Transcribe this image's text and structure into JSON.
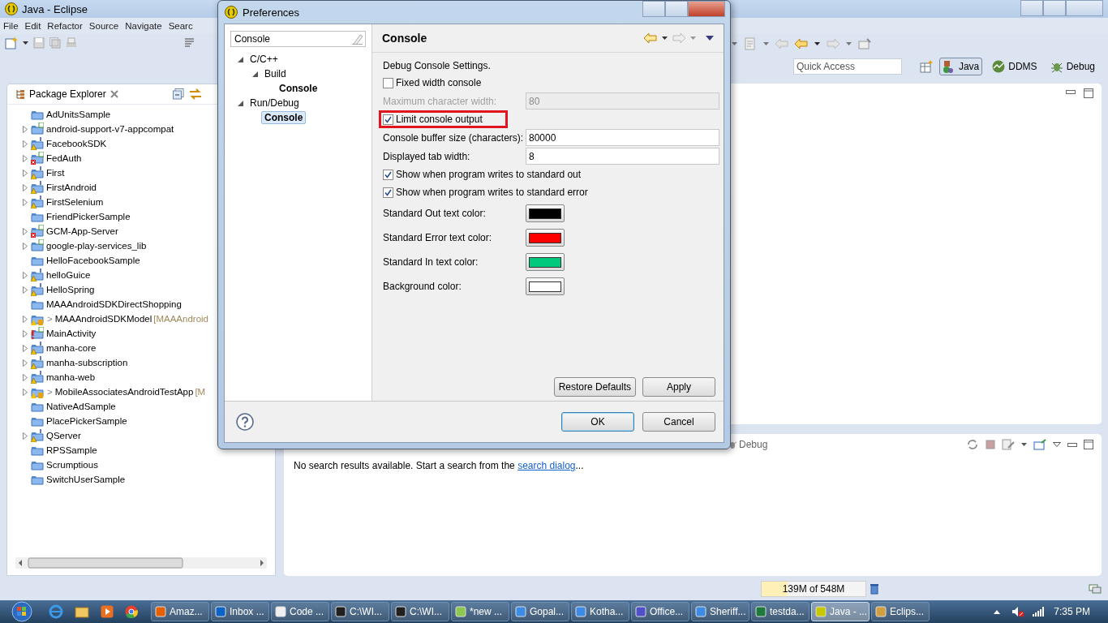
{
  "window": {
    "title": "Java - Eclipse"
  },
  "menu": [
    "File",
    "Edit",
    "Refactor",
    "Source",
    "Navigate",
    "Searc"
  ],
  "quick_access": {
    "placeholder": "Quick Access"
  },
  "perspectives": [
    {
      "label": "Java",
      "selected": true
    },
    {
      "label": "DDMS",
      "selected": false
    },
    {
      "label": "Debug",
      "selected": false
    }
  ],
  "package_explorer": {
    "title": "Package Explorer",
    "items": [
      {
        "name": "AdUnitsSample",
        "kind": "folder",
        "expandable": false
      },
      {
        "name": "android-support-v7-appcompat",
        "kind": "project",
        "expandable": true
      },
      {
        "name": "FacebookSDK",
        "kind": "warning",
        "expandable": true
      },
      {
        "name": "FedAuth",
        "kind": "error",
        "expandable": true
      },
      {
        "name": "First",
        "kind": "warning",
        "expandable": true
      },
      {
        "name": "FirstAndroid",
        "kind": "warning",
        "expandable": true
      },
      {
        "name": "FirstSelenium",
        "kind": "warning",
        "expandable": true
      },
      {
        "name": "FriendPickerSample",
        "kind": "folder",
        "expandable": false
      },
      {
        "name": "GCM-App-Server",
        "kind": "error",
        "expandable": true
      },
      {
        "name": "google-play-services_lib",
        "kind": "project",
        "expandable": true
      },
      {
        "name": "HelloFacebookSample",
        "kind": "folder",
        "expandable": false
      },
      {
        "name": "helloGuice",
        "kind": "warning",
        "expandable": true
      },
      {
        "name": "HelloSpring",
        "kind": "warning",
        "expandable": true
      },
      {
        "name": "MAAAndroidSDKDirectShopping",
        "kind": "folder",
        "expandable": false
      },
      {
        "name": "MAAAndroidSDKModel",
        "kind": "repository",
        "expandable": true,
        "prefix": ">",
        "suffix": "[MAAAndroid"
      },
      {
        "name": "MainActivity",
        "kind": "problem",
        "expandable": true
      },
      {
        "name": "manha-core",
        "kind": "warning",
        "expandable": true
      },
      {
        "name": "manha-subscription",
        "kind": "warning",
        "expandable": true
      },
      {
        "name": "manha-web",
        "kind": "warning",
        "expandable": true
      },
      {
        "name": "MobileAssociatesAndroidTestApp",
        "kind": "repository",
        "expandable": true,
        "prefix": ">",
        "suffix": "[M"
      },
      {
        "name": "NativeAdSample",
        "kind": "folder",
        "expandable": false
      },
      {
        "name": "PlacePickerSample",
        "kind": "folder",
        "expandable": false
      },
      {
        "name": "QServer",
        "kind": "warning",
        "expandable": true
      },
      {
        "name": "RPSSample",
        "kind": "folder",
        "expandable": false
      },
      {
        "name": "Scrumptious",
        "kind": "folder",
        "expandable": false
      },
      {
        "name": "SwitchUserSample",
        "kind": "folder",
        "expandable": false
      }
    ]
  },
  "bottom_panel": {
    "tab": "Debug",
    "message": "No search results available. Start a search from the",
    "link": "search dialog",
    "ellipsis": "..."
  },
  "status_bar": {
    "memory": "139M of 548M",
    "level": 0.25
  },
  "dialog": {
    "title": "Preferences",
    "filter": "Console",
    "tree": [
      {
        "label": "C/C++",
        "matched": false,
        "selected": false,
        "expanded": true,
        "children": [
          {
            "label": "Build",
            "matched": false,
            "selected": false,
            "expanded": true,
            "children": [
              {
                "label": "Console",
                "matched": true,
                "selected": false
              }
            ]
          }
        ]
      },
      {
        "label": "Run/Debug",
        "matched": false,
        "selected": false,
        "expanded": true,
        "children": [
          {
            "label": "Console",
            "matched": true,
            "selected": true
          }
        ]
      }
    ],
    "page_title": "Console",
    "description": "Debug Console Settings.",
    "settings": [
      {
        "kind": "checkbox",
        "label": "Fixed width console",
        "checked": false,
        "annotated": false
      },
      {
        "kind": "field",
        "label": "Maximum character width:",
        "value": "80",
        "disabled": true
      },
      {
        "kind": "checkbox",
        "label": "Limit console output",
        "checked": true,
        "annotated": true
      },
      {
        "kind": "field",
        "label": "Console buffer size (characters):",
        "value": "80000",
        "disabled": false
      },
      {
        "kind": "field",
        "label": "Displayed tab width:",
        "value": "8",
        "disabled": false
      },
      {
        "kind": "checkbox",
        "label": "Show when program writes to standard out",
        "checked": true,
        "annotated": false
      },
      {
        "kind": "checkbox",
        "label": "Show when program writes to standard error",
        "checked": true,
        "annotated": false
      },
      {
        "kind": "color",
        "label": "Standard Out text color:",
        "color": "#000000"
      },
      {
        "kind": "color",
        "label": "Standard Error text color:",
        "color": "#ff0000"
      },
      {
        "kind": "color",
        "label": "Standard In text color:",
        "color": "#00c87d"
      },
      {
        "kind": "color",
        "label": "Background color:",
        "color": "#ffffff"
      }
    ],
    "page_buttons": [
      "Restore Defaults",
      "Apply"
    ],
    "buttons": [
      {
        "label": "OK",
        "default": true
      },
      {
        "label": "Cancel",
        "default": false
      }
    ]
  },
  "taskbar": {
    "items": [
      {
        "label": "Amaz...",
        "color": "#e66000",
        "selected": false
      },
      {
        "label": "Inbox ...",
        "color": "#0a64c8",
        "selected": false
      },
      {
        "label": "Code ...",
        "color": "#f0f0f0",
        "selected": false
      },
      {
        "label": "C:\\WI...",
        "color": "#202020",
        "selected": false
      },
      {
        "label": "C:\\WI...",
        "color": "#202020",
        "selected": false
      },
      {
        "label": "*new ...",
        "color": "#8cc850",
        "selected": false
      },
      {
        "label": "Gopal...",
        "color": "#3c8ce6",
        "selected": false
      },
      {
        "label": "Kotha...",
        "color": "#3c8ce6",
        "selected": false
      },
      {
        "label": "Office...",
        "color": "#5050c8",
        "selected": false
      },
      {
        "label": "Sheriff...",
        "color": "#3c8ce6",
        "selected": false
      },
      {
        "label": "testda...",
        "color": "#1e7a3c",
        "selected": false
      },
      {
        "label": "Java - ...",
        "color": "#c8c800",
        "selected": true
      },
      {
        "label": "Eclips...",
        "color": "#d0a040",
        "selected": false
      }
    ],
    "time": "7:35 PM"
  }
}
